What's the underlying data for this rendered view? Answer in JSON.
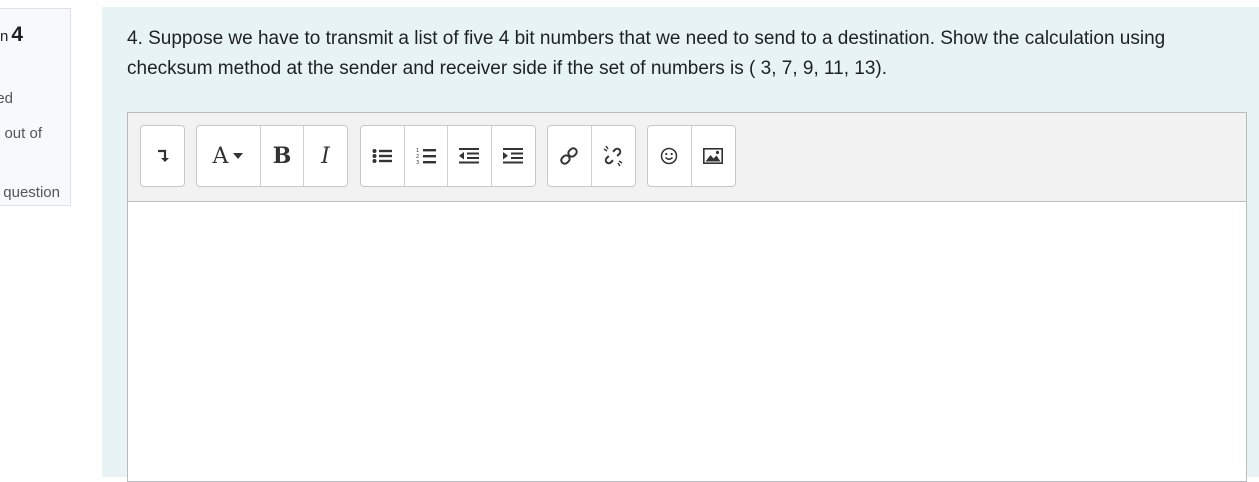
{
  "info": {
    "question_prefix": "n",
    "question_number": "4",
    "status_fragment": "ed",
    "marks_fragment": "out of",
    "flag_fragment": "question"
  },
  "question": {
    "text": "4. Suppose we have to transmit a list of five 4 bit numbers that we need to send to a destination. Show the calculation using checksum method at the sender and receiver side if the set of numbers is ( 3, 7, 9, 11, 13)."
  },
  "toolbar": {
    "groups": [
      {
        "buttons": [
          {
            "icon": "expand-toolbar-icon"
          }
        ]
      },
      {
        "buttons": [
          {
            "icon": "font-style-icon",
            "label": "A"
          },
          {
            "icon": "bold-icon",
            "label": "B"
          },
          {
            "icon": "italic-icon",
            "label": "I"
          }
        ]
      },
      {
        "buttons": [
          {
            "icon": "unordered-list-icon"
          },
          {
            "icon": "ordered-list-icon"
          },
          {
            "icon": "outdent-icon"
          },
          {
            "icon": "indent-icon"
          }
        ]
      },
      {
        "buttons": [
          {
            "icon": "link-icon"
          },
          {
            "icon": "unlink-icon"
          }
        ]
      },
      {
        "buttons": [
          {
            "icon": "emoji-icon"
          },
          {
            "icon": "image-icon"
          }
        ]
      }
    ]
  },
  "colors": {
    "content_bg": "#e7f3f5",
    "toolbar_bg": "#f2f2f2",
    "info_bg": "#f8f9fa"
  }
}
